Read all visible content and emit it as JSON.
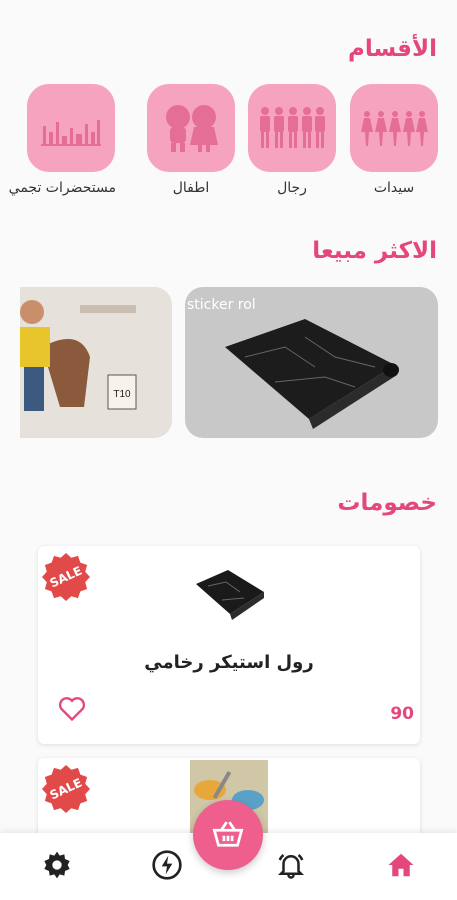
{
  "sections": {
    "categories_title": "الأقسام",
    "best_selling_title": "الاكثر مبيعا",
    "discounts_title": "خصومات"
  },
  "categories": [
    {
      "label": "سيدات",
      "icon": "women-group-icon"
    },
    {
      "label": "رجال",
      "icon": "men-group-icon"
    },
    {
      "label": "اطفال",
      "icon": "kids-icon"
    },
    {
      "label": "مستحضرات تجمي",
      "icon": "cosmetics-icon"
    }
  ],
  "best_selling": [
    {
      "caption": "sticker rol",
      "image": "marble-sticker-roll"
    },
    {
      "caption": "",
      "image": "kids-clothing-model"
    }
  ],
  "discounts": [
    {
      "badge": "SALE",
      "title": "رول استيكر رخامي",
      "price": "90",
      "image": "marble-sticker-roll"
    },
    {
      "badge": "SALE",
      "title": "",
      "price": "",
      "image": "food-containers"
    }
  ],
  "nav": {
    "items": [
      "home-icon",
      "notifications-icon",
      "cart-icon",
      "offers-icon",
      "settings-icon"
    ]
  },
  "colors": {
    "accent": "#e4477d",
    "tile": "#f6a3c0",
    "sale": "#e24a4a",
    "price": "#e4477d"
  }
}
